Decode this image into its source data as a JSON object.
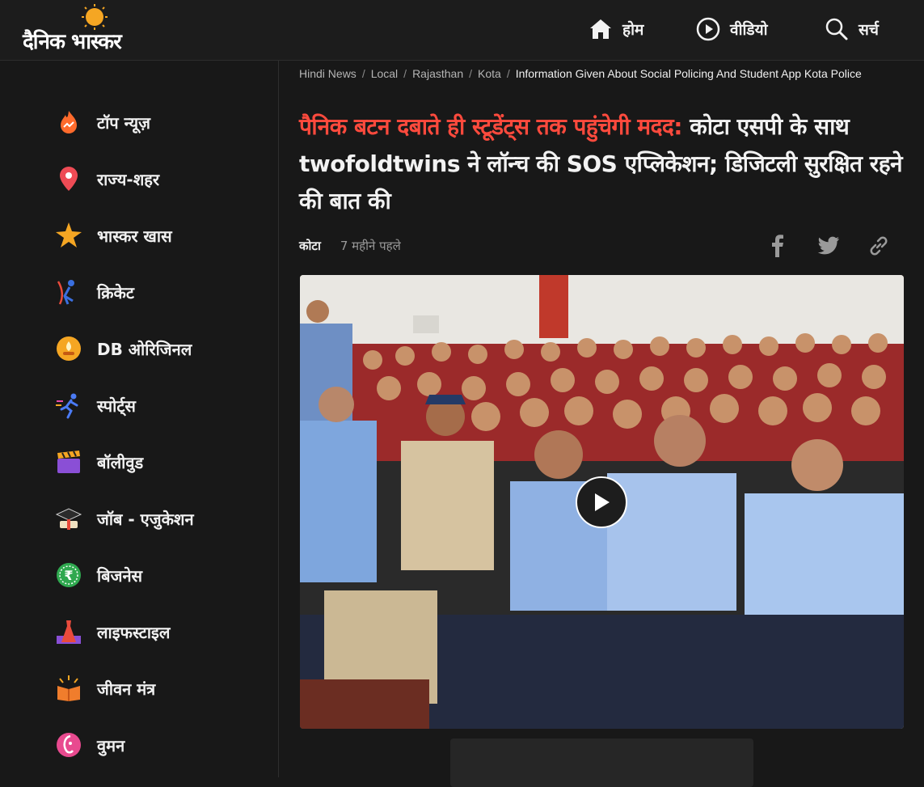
{
  "header": {
    "logo": "दैनिक भास्कर",
    "nav": [
      {
        "label": "होम",
        "icon": "home-icon"
      },
      {
        "label": "वीडियो",
        "icon": "play-circle-icon"
      },
      {
        "label": "सर्च",
        "icon": "search-icon"
      }
    ]
  },
  "sidebar": {
    "items": [
      {
        "label": "टॉप न्यूज़",
        "icon": "flame-trend-icon"
      },
      {
        "label": "राज्य-शहर",
        "icon": "location-pin-icon"
      },
      {
        "label": "भास्कर खास",
        "icon": "star-burst-icon"
      },
      {
        "label": "क्रिकेट",
        "icon": "cricket-batsman-icon"
      },
      {
        "label": "DB ओरिजिनल",
        "icon": "lamp-icon"
      },
      {
        "label": "स्पोर्ट्स",
        "icon": "runner-icon"
      },
      {
        "label": "बॉलीवुड",
        "icon": "clapperboard-icon"
      },
      {
        "label": "जॉब - एजुकेशन",
        "icon": "graduation-cap-icon"
      },
      {
        "label": "बिजनेस",
        "icon": "rupee-coin-icon"
      },
      {
        "label": "लाइफस्टाइल",
        "icon": "dress-icon"
      },
      {
        "label": "जीवन मंत्र",
        "icon": "book-sun-icon"
      },
      {
        "label": "वुमन",
        "icon": "woman-face-icon"
      }
    ]
  },
  "breadcrumb": [
    {
      "label": "Hindi News"
    },
    {
      "label": "Local"
    },
    {
      "label": "Rajasthan"
    },
    {
      "label": "Kota"
    },
    {
      "label": "Information Given About Social Policing And Student App Kota Police"
    }
  ],
  "article": {
    "headline_highlight": "पैनिक बटन दबाते ही स्टूडेंट्स तक पहुंचेगी मदद:",
    "headline_rest": " कोटा एसपी के साथ twofoldtwins ने लॉन्च की SOS एप्लिकेशन; डिजिटली सुरक्षित रहने की बात की",
    "city": "कोटा",
    "time": "7 महीने पहले",
    "share_icons": [
      "facebook-icon",
      "twitter-icon",
      "link-icon"
    ]
  },
  "colors": {
    "background": "#181818",
    "accent_red": "#ff4a3d",
    "sun": "#f5a623"
  }
}
